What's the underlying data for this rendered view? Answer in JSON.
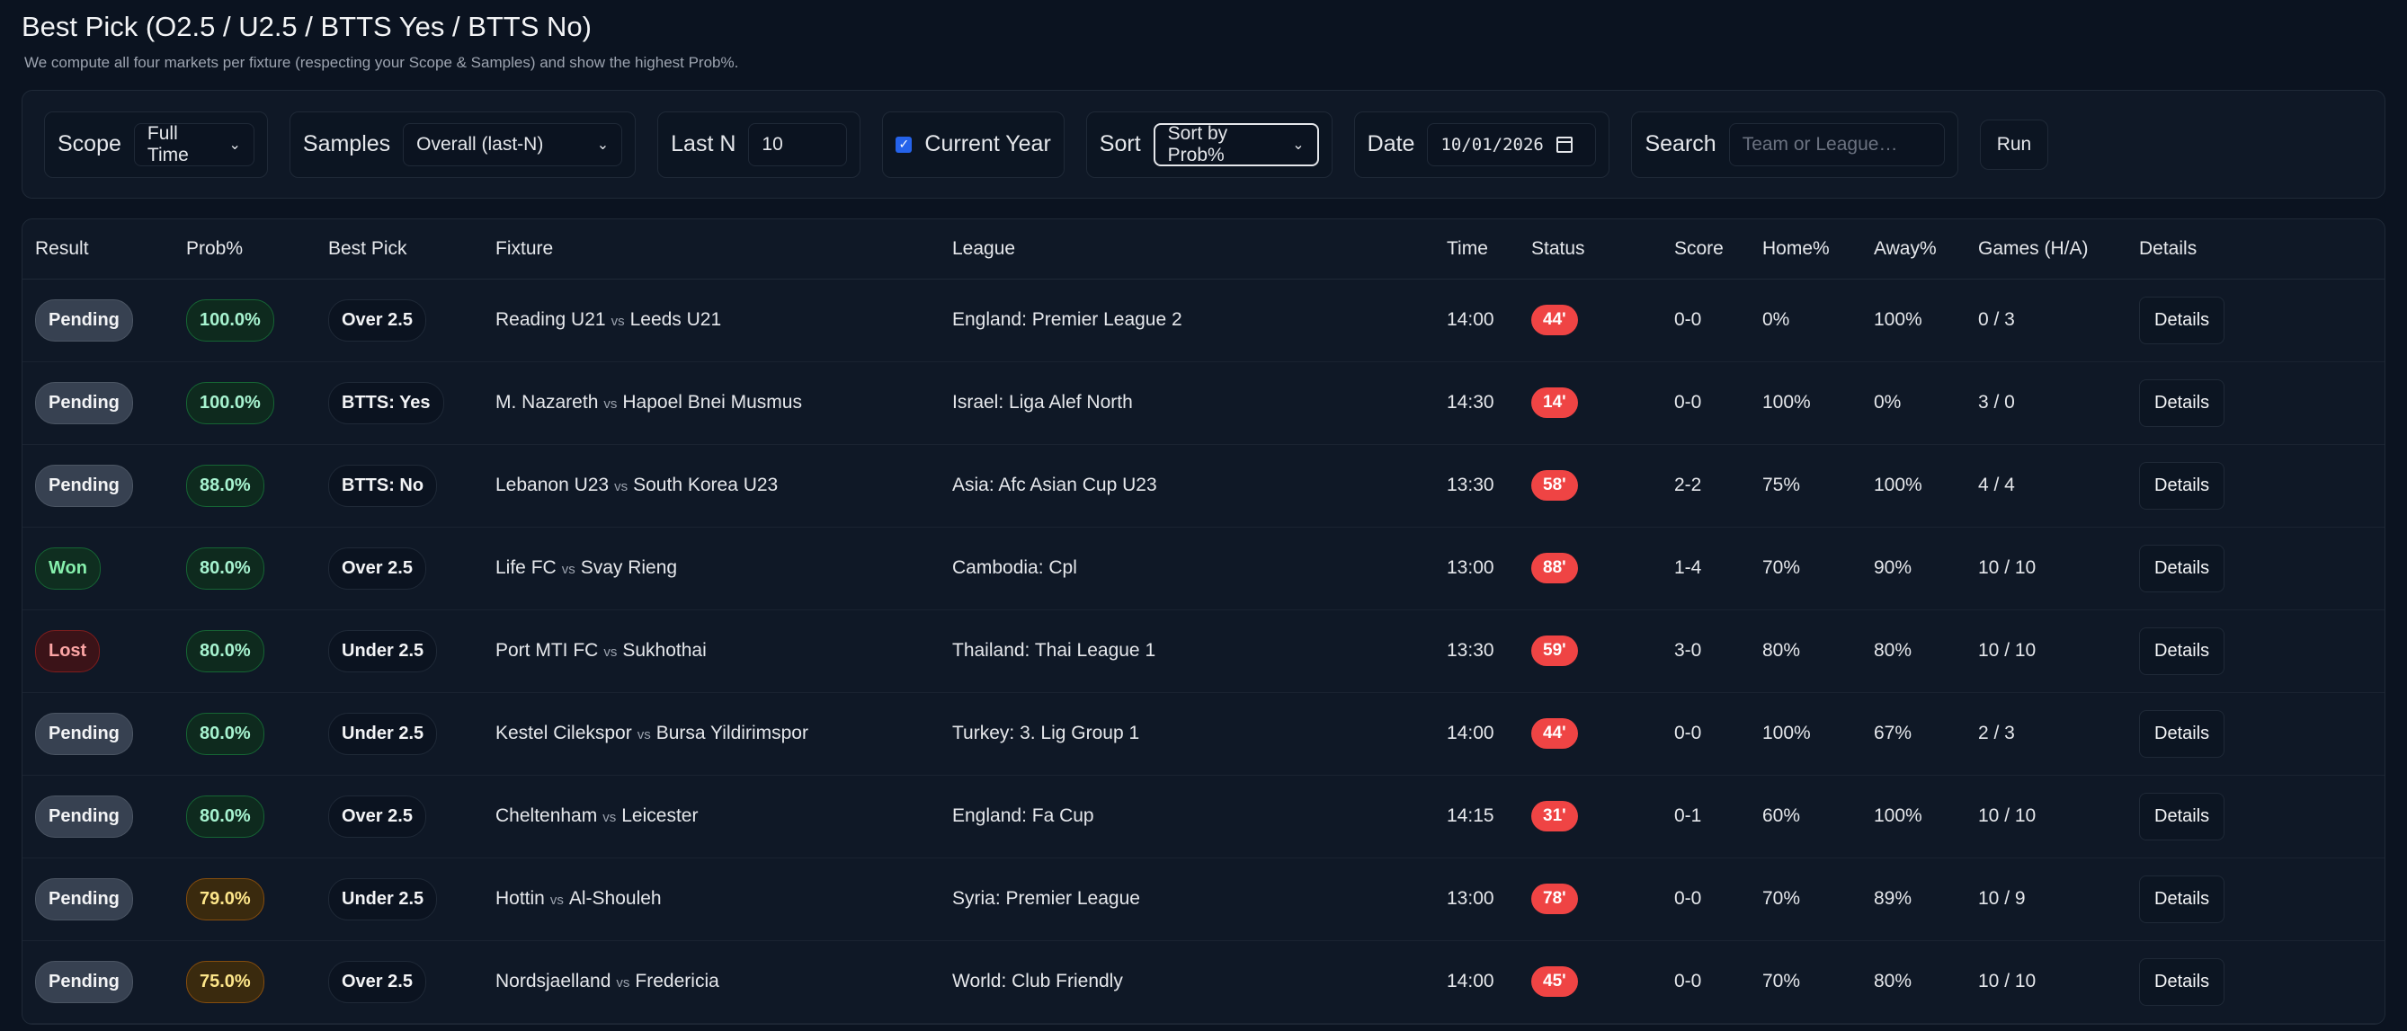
{
  "header": {
    "title": "Best Pick (O2.5 / U2.5 / BTTS Yes / BTTS No)",
    "subtitle": "We compute all four markets per fixture (respecting your Scope & Samples) and show the highest Prob%."
  },
  "controls": {
    "scope": {
      "label": "Scope",
      "value": "Full Time"
    },
    "samples": {
      "label": "Samples",
      "value": "Overall (last-N)"
    },
    "lastn": {
      "label": "Last N",
      "value": "10"
    },
    "current_year": {
      "label": "Current Year",
      "checked": true
    },
    "sort": {
      "label": "Sort",
      "value": "Sort by Prob%"
    },
    "date": {
      "label": "Date",
      "value": "10/01/2026"
    },
    "search": {
      "label": "Search",
      "placeholder": "Team or League…"
    },
    "run_label": "Run"
  },
  "table": {
    "headers": [
      "Result",
      "Prob%",
      "Best Pick",
      "Fixture",
      "League",
      "Time",
      "Status",
      "Score",
      "Home%",
      "Away%",
      "Games (H/A)",
      "Details"
    ],
    "vs": "vs",
    "details_label": "Details",
    "rows": [
      {
        "result": "Pending",
        "result_type": "pending",
        "prob": "100.0%",
        "prob_color": "green",
        "pick": "Over 2.5",
        "home": "Reading U21",
        "away": "Leeds U21",
        "league": "England: Premier League 2",
        "time": "14:00",
        "status": "44'",
        "score": "0-0",
        "home_pct": "0%",
        "away_pct": "100%",
        "games": "0 / 3"
      },
      {
        "result": "Pending",
        "result_type": "pending",
        "prob": "100.0%",
        "prob_color": "green",
        "pick": "BTTS: Yes",
        "home": "M. Nazareth",
        "away": "Hapoel Bnei Musmus",
        "league": "Israel: Liga Alef North",
        "time": "14:30",
        "status": "14'",
        "score": "0-0",
        "home_pct": "100%",
        "away_pct": "0%",
        "games": "3 / 0"
      },
      {
        "result": "Pending",
        "result_type": "pending",
        "prob": "88.0%",
        "prob_color": "green",
        "pick": "BTTS: No",
        "home": "Lebanon U23",
        "away": "South Korea U23",
        "league": "Asia: Afc Asian Cup U23",
        "time": "13:30",
        "status": "58'",
        "score": "2-2",
        "home_pct": "75%",
        "away_pct": "100%",
        "games": "4 / 4"
      },
      {
        "result": "Won",
        "result_type": "won",
        "prob": "80.0%",
        "prob_color": "green",
        "pick": "Over 2.5",
        "home": "Life FC",
        "away": "Svay Rieng",
        "league": "Cambodia: Cpl",
        "time": "13:00",
        "status": "88'",
        "score": "1-4",
        "home_pct": "70%",
        "away_pct": "90%",
        "games": "10 / 10"
      },
      {
        "result": "Lost",
        "result_type": "lost",
        "prob": "80.0%",
        "prob_color": "green",
        "pick": "Under 2.5",
        "home": "Port MTI FC",
        "away": "Sukhothai",
        "league": "Thailand: Thai League 1",
        "time": "13:30",
        "status": "59'",
        "score": "3-0",
        "home_pct": "80%",
        "away_pct": "80%",
        "games": "10 / 10"
      },
      {
        "result": "Pending",
        "result_type": "pending",
        "prob": "80.0%",
        "prob_color": "green",
        "pick": "Under 2.5",
        "home": "Kestel Cilekspor",
        "away": "Bursa Yildirimspor",
        "league": "Turkey: 3. Lig Group 1",
        "time": "14:00",
        "status": "44'",
        "score": "0-0",
        "home_pct": "100%",
        "away_pct": "67%",
        "games": "2 / 3"
      },
      {
        "result": "Pending",
        "result_type": "pending",
        "prob": "80.0%",
        "prob_color": "green",
        "pick": "Over 2.5",
        "home": "Cheltenham",
        "away": "Leicester",
        "league": "England: Fa Cup",
        "time": "14:15",
        "status": "31'",
        "score": "0-1",
        "home_pct": "60%",
        "away_pct": "100%",
        "games": "10 / 10"
      },
      {
        "result": "Pending",
        "result_type": "pending",
        "prob": "79.0%",
        "prob_color": "yellow",
        "pick": "Under 2.5",
        "home": "Hottin",
        "away": "Al-Shouleh",
        "league": "Syria: Premier League",
        "time": "13:00",
        "status": "78'",
        "score": "0-0",
        "home_pct": "70%",
        "away_pct": "89%",
        "games": "10 / 9"
      },
      {
        "result": "Pending",
        "result_type": "pending",
        "prob": "75.0%",
        "prob_color": "yellow",
        "pick": "Over 2.5",
        "home": "Nordsjaelland",
        "away": "Fredericia",
        "league": "World: Club Friendly",
        "time": "14:00",
        "status": "45'",
        "score": "0-0",
        "home_pct": "70%",
        "away_pct": "80%",
        "games": "10 / 10"
      }
    ]
  }
}
